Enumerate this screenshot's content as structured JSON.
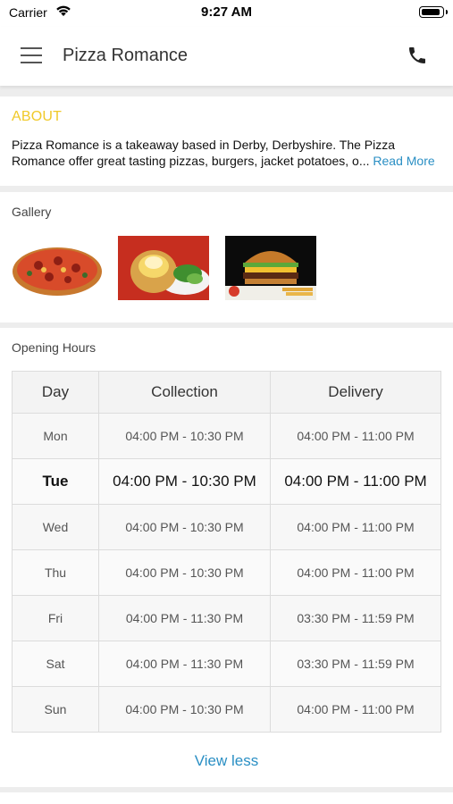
{
  "status_bar": {
    "carrier": "Carrier",
    "time": "9:27 AM"
  },
  "header": {
    "title": "Pizza Romance"
  },
  "about": {
    "title": "ABOUT",
    "text": "Pizza Romance is a takeaway based in Derby, Derbyshire. The Pizza Romance offer great tasting pizzas, burgers, jacket potatoes, o...",
    "read_more": "Read More"
  },
  "gallery": {
    "label": "Gallery"
  },
  "opening_hours": {
    "label": "Opening Hours",
    "columns": [
      "Day",
      "Collection",
      "Delivery"
    ],
    "rows": [
      {
        "day": "Mon",
        "collection": "04:00 PM - 10:30 PM",
        "delivery": "04:00 PM - 11:00 PM"
      },
      {
        "day": "Tue",
        "collection": "04:00 PM - 10:30 PM",
        "delivery": "04:00 PM - 11:00 PM"
      },
      {
        "day": "Wed",
        "collection": "04:00 PM - 10:30 PM",
        "delivery": "04:00 PM - 11:00 PM"
      },
      {
        "day": "Thu",
        "collection": "04:00 PM - 10:30 PM",
        "delivery": "04:00 PM - 11:00 PM"
      },
      {
        "day": "Fri",
        "collection": "04:00 PM - 11:30 PM",
        "delivery": "03:30 PM - 11:59 PM"
      },
      {
        "day": "Sat",
        "collection": "04:00 PM - 11:30 PM",
        "delivery": "03:30 PM - 11:59 PM"
      },
      {
        "day": "Sun",
        "collection": "04:00 PM - 10:30 PM",
        "delivery": "04:00 PM - 11:00 PM"
      }
    ],
    "view_less": "View less"
  },
  "colors": {
    "about_title": "#f0c929",
    "link": "#2a8fc4"
  }
}
